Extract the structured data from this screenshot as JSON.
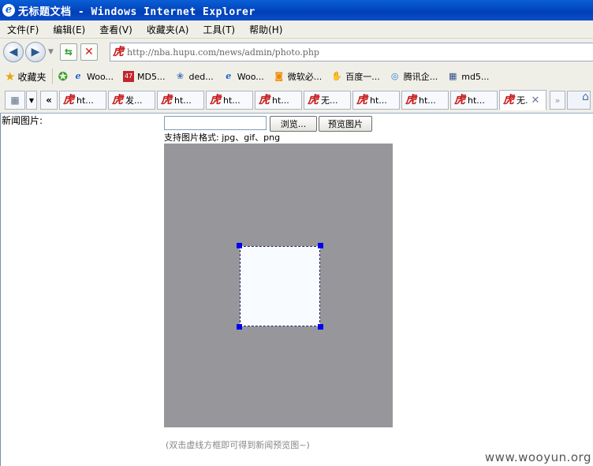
{
  "window": {
    "title": "无标题文档 - Windows Internet Explorer"
  },
  "menu": {
    "items": [
      "文件(F)",
      "编辑(E)",
      "查看(V)",
      "收藏夹(A)",
      "工具(T)",
      "帮助(H)"
    ]
  },
  "address": {
    "url": "http://nba.hupu.com/news/admin/photo.php"
  },
  "favorites": {
    "label": "收藏夹",
    "items": [
      {
        "label": "Woo...",
        "icon": "ie-icon"
      },
      {
        "label": "MD5...",
        "icon": "md5-icon"
      },
      {
        "label": "ded...",
        "icon": "dede-icon"
      },
      {
        "label": "Woo...",
        "icon": "ie-icon"
      },
      {
        "label": "微软必...",
        "icon": "ms-icon"
      },
      {
        "label": "百度一...",
        "icon": "baidu-icon"
      },
      {
        "label": "腾讯企...",
        "icon": "qq-icon"
      },
      {
        "label": "md5...",
        "icon": "grid-icon"
      }
    ]
  },
  "tabs": {
    "back_label": "«",
    "more_label": "»",
    "items": [
      {
        "label": "ht..."
      },
      {
        "label": "发..."
      },
      {
        "label": "ht..."
      },
      {
        "label": "ht..."
      },
      {
        "label": "ht..."
      },
      {
        "label": "无..."
      },
      {
        "label": "ht..."
      },
      {
        "label": "ht..."
      },
      {
        "label": "ht..."
      },
      {
        "label": "无."
      }
    ]
  },
  "page": {
    "news_image_label": "新闻图片:",
    "browse_button": "浏览...",
    "preview_button": "预览图片",
    "formats_text": "支持图片格式: jpg、gif、png",
    "hint_text": "(双击虚线方框即可得到新闻预览图~)",
    "watermark": "www.wooyun.org"
  },
  "colors": {
    "accent": "#0a4fc8",
    "preview_bg": "#97979b",
    "handle": "#0000ee"
  }
}
